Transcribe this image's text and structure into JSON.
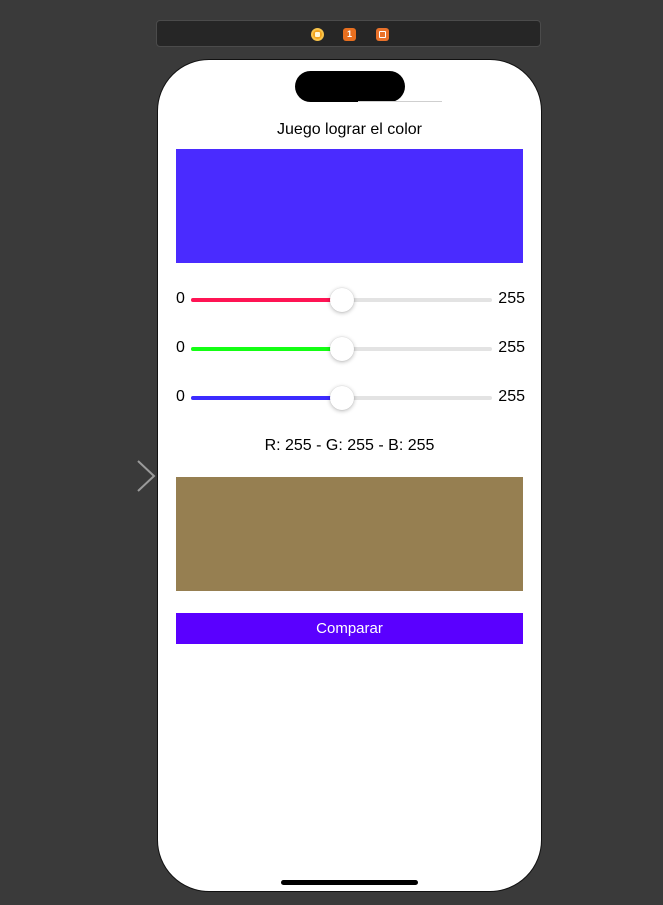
{
  "scene_dock": {
    "items": [
      {
        "icon": "view-controller-icon"
      },
      {
        "icon": "first-responder-icon",
        "glyph": "1"
      },
      {
        "icon": "exit-icon"
      }
    ]
  },
  "title": "Juego lograr el color",
  "target_swatch": {
    "color": "#4a2bff"
  },
  "sliders": [
    {
      "name": "red",
      "min_label": "0",
      "max_label": "255",
      "value": 0.5,
      "tint": "#ff1454"
    },
    {
      "name": "green",
      "min_label": "0",
      "max_label": "255",
      "value": 0.5,
      "tint": "#14ff14"
    },
    {
      "name": "blue",
      "min_label": "0",
      "max_label": "255",
      "value": 0.5,
      "tint": "#3c2bff"
    }
  ],
  "rgb_label": "R: 255 - G: 255 - B: 255",
  "player_swatch": {
    "color": "#967f51"
  },
  "compare_button": {
    "label": "Comparar",
    "color": "#5a00ff"
  }
}
